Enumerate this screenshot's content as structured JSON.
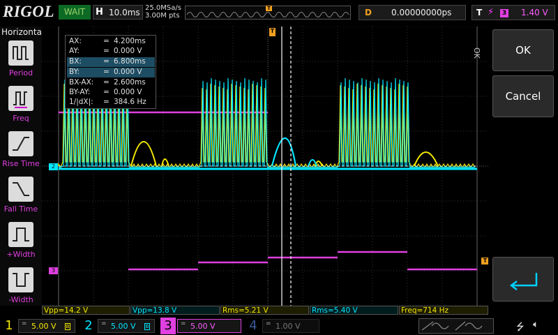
{
  "brand": "RIGOL",
  "status": "WAIT",
  "timebase": {
    "label": "H",
    "value": "10.0ms"
  },
  "sample": {
    "rate": "25.0MSa/s",
    "points": "3.00M pts"
  },
  "trigger_marker": "T",
  "delay": {
    "label": "D",
    "value": "0.00000000ps"
  },
  "trigger": {
    "label": "T",
    "edge_icon": "rising-edge-icon",
    "source": "3",
    "level": "1.40 V"
  },
  "left_panel": {
    "title": "Horizontal",
    "items": [
      {
        "label": "Period",
        "icon": "period-icon"
      },
      {
        "label": "Freq",
        "icon": "freq-icon"
      },
      {
        "label": "Rise Time",
        "icon": "rise-time-icon"
      },
      {
        "label": "Fall Time",
        "icon": "fall-time-icon"
      },
      {
        "label": "+Width",
        "icon": "pos-width-icon"
      },
      {
        "label": "-Width",
        "icon": "neg-width-icon"
      }
    ]
  },
  "cursors": [
    {
      "name": "AX:",
      "eq": "=",
      "value": "4.200ms",
      "selected": false
    },
    {
      "name": "AY:",
      "eq": "=",
      "value": "0.000 V",
      "selected": false
    },
    {
      "name": "BX:",
      "eq": "=",
      "value": "6.800ms",
      "selected": true
    },
    {
      "name": "BY:",
      "eq": "=",
      "value": "0.000 V",
      "selected": true
    },
    {
      "name": "BX-AX:",
      "eq": "=",
      "value": "2.600ms",
      "selected": false
    },
    {
      "name": "BY-AY:",
      "eq": "=",
      "value": "0.000 V",
      "selected": false
    },
    {
      "name": "1/|dX|:",
      "eq": "=",
      "value": "384.6 Hz",
      "selected": false
    }
  ],
  "markers": {
    "ch2": "2",
    "ch3": "3",
    "trig_level": "T"
  },
  "right_panel": {
    "ok_side": "OK",
    "ok": "OK",
    "cancel": "Cancel",
    "enter_icon": "enter-arrow-icon"
  },
  "measurements": [
    {
      "text": "Vpp=14.2 V",
      "color": "yellow"
    },
    {
      "text": "Vpp=13.8 V",
      "color": "cyan"
    },
    {
      "text": "Rms=5.21 V",
      "color": "yellow"
    },
    {
      "text": "Rms=5.40 V",
      "color": "cyan"
    },
    {
      "text": "Freq=714 Hz",
      "color": "yellow"
    }
  ],
  "channels": [
    {
      "num": "1",
      "coupling": "=",
      "scale": "5.00 V",
      "bw": "B",
      "color": "#f5e900"
    },
    {
      "num": "2",
      "coupling": "=",
      "scale": "5.00 V",
      "bw": "B",
      "color": "#00e8ff"
    },
    {
      "num": "3",
      "coupling": "=",
      "scale": "5.00 V",
      "bw": "",
      "color": "#e040e0"
    },
    {
      "num": "4",
      "coupling": "=",
      "scale": "1.00 V",
      "bw": "",
      "color": "#3a5a9a"
    }
  ],
  "colors": {
    "ch1": "#f5e900",
    "ch2": "#00e8ff",
    "ch3": "#e040e0",
    "trigger": "#f0a020"
  }
}
